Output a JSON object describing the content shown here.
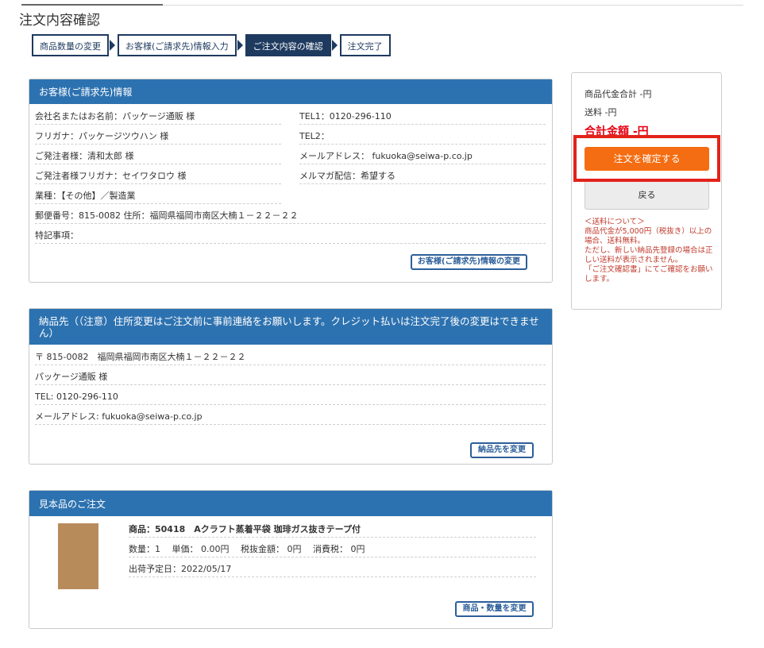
{
  "page_title": "注文内容確認",
  "steps": [
    "商品数量の変更",
    "お客様(ご請求先)情報入力",
    "ご注文内容の確認",
    "注文完了"
  ],
  "customer": {
    "header": "お客様(ご請求先)情報",
    "company": "会社名またはお名前：パッケージ通販 様",
    "kana": "フリガナ：パッケージツウハン 様",
    "orderer": "ご発注者様：清和太郎 様",
    "orderer_kana": "ご発注者様フリガナ：セイワタロウ 様",
    "industry": "業種：【その他】／製造業",
    "address": "郵便番号：815-0082  住所：福岡県福岡市南区大楠１－２２－２２",
    "notes": "特記事項：",
    "tel1": "TEL1：0120-296-110",
    "tel2": "TEL2：",
    "email": "メールアドレス： fukuoka@seiwa-p.co.jp",
    "magazine": "メルマガ配信：希望する",
    "change_button": "お客様(ご請求先)情報の変更"
  },
  "delivery": {
    "header": "納品先（（注意）住所変更はご注文前に事前連絡をお願いします。クレジット払いは注文完了後の変更はできません）",
    "zip_address": "〒 815-0082　福岡県福岡市南区大楠１－２２－２２",
    "name": "パッケージ通販 様",
    "tel": "TEL: 0120-296-110",
    "email": "メールアドレス: fukuoka@seiwa-p.co.jp",
    "change_button": "納品先を変更"
  },
  "sample": {
    "header": "見本品のご注文",
    "product": "商品：50418　Aクラフト蒸着平袋 珈琲ガス抜きテープ付",
    "qty_price": "数量：1　 単価： 0.00円　 税抜金額： 0円　 消費税： 0円",
    "ship_date": "出荷予定日：2022/05/17",
    "change_button": "商品・数量を変更"
  },
  "summary": {
    "subtotal": "商品代金合計 -円",
    "shipping": "送料 -円",
    "total": "合計金額 -円",
    "confirm_button": "注文を確定する",
    "back_button": "戻る",
    "note": "＜送料について＞\n商品代金が5,000円（税抜き）以上の場合、送料無料。\nただし、新しい納品先登録の場合は正しい送料が表示されません。\n「ご注文確認書」にてご確認をお願いします。"
  }
}
